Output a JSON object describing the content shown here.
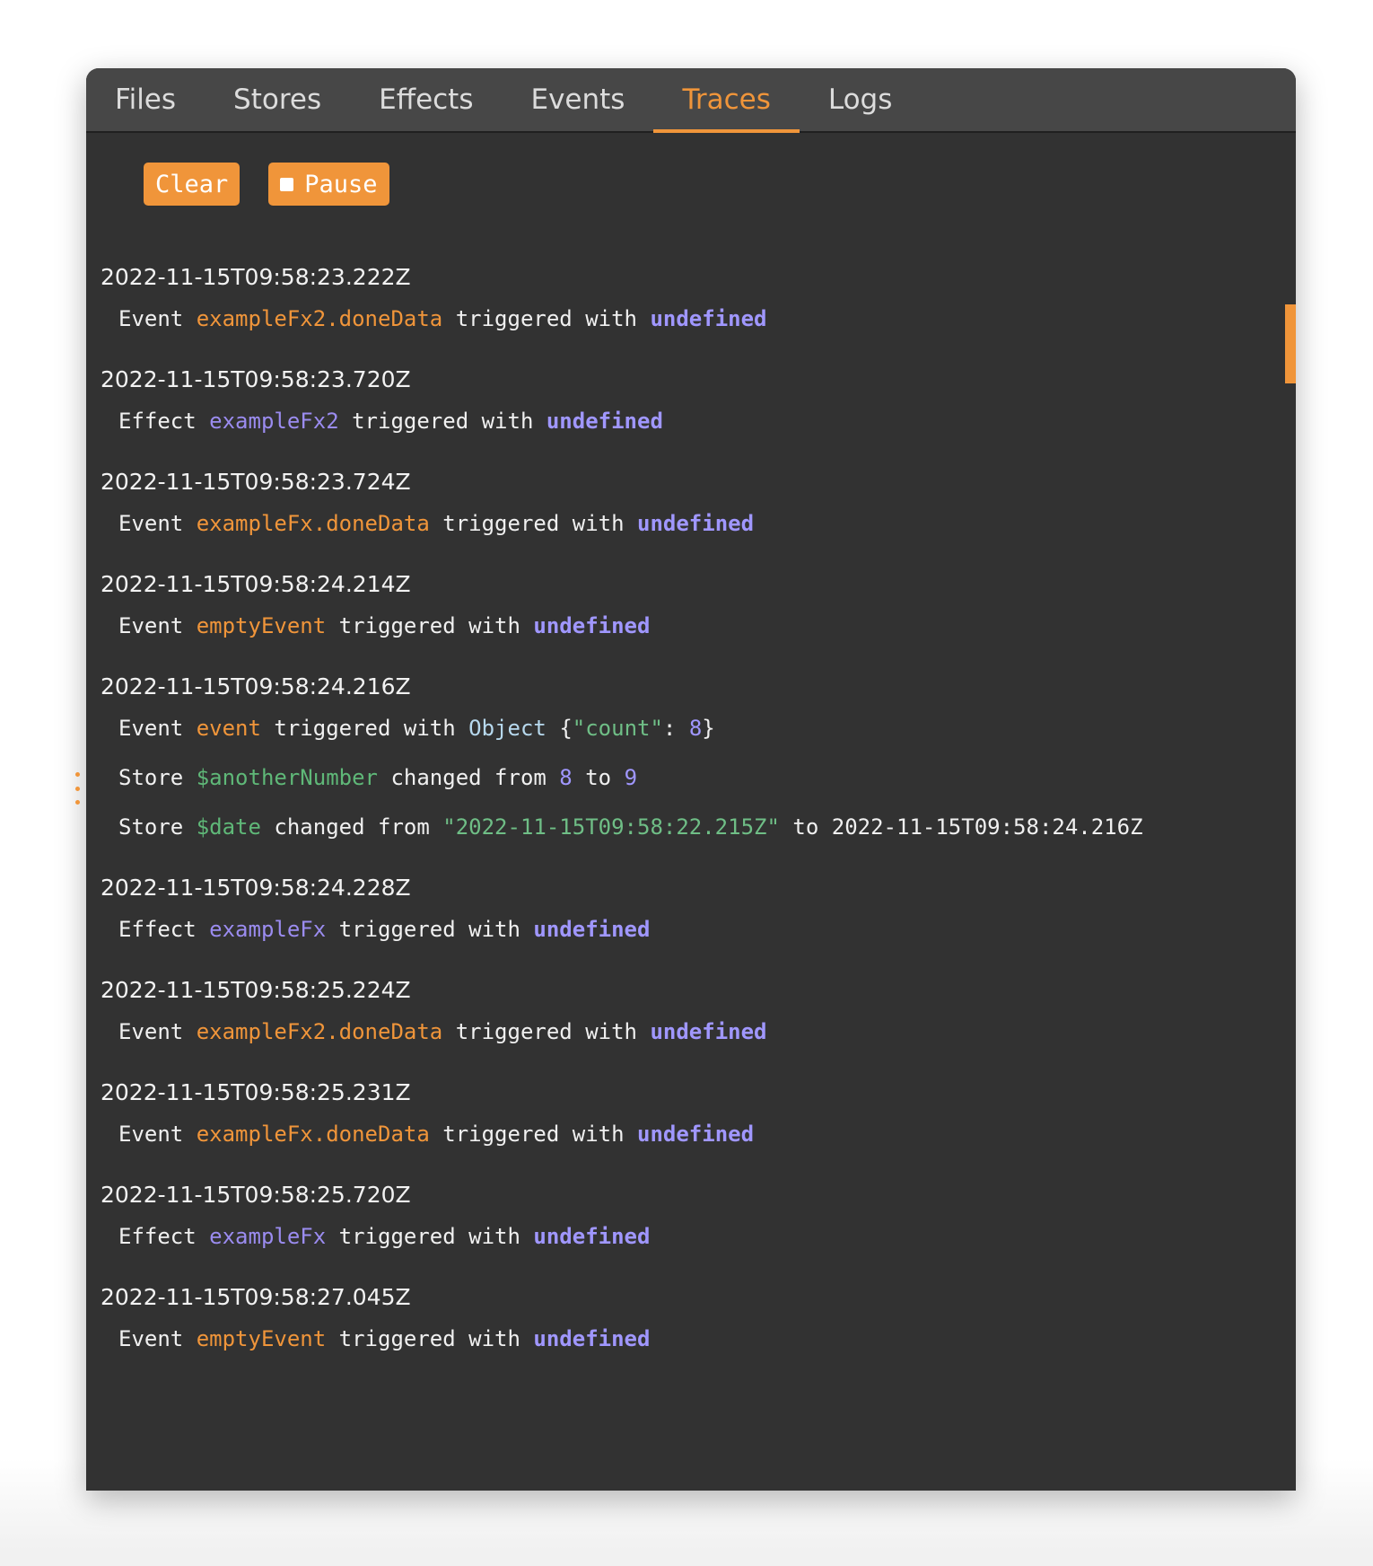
{
  "tabs": [
    {
      "label": "Files",
      "active": false
    },
    {
      "label": "Stores",
      "active": false
    },
    {
      "label": "Effects",
      "active": false
    },
    {
      "label": "Events",
      "active": false
    },
    {
      "label": "Traces",
      "active": true
    },
    {
      "label": "Logs",
      "active": false
    }
  ],
  "toolbar": {
    "clear_label": "Clear",
    "pause_label": "Pause",
    "pause_icon": "stop-square-icon"
  },
  "colors": {
    "accent": "#f0953a",
    "panel_background": "#323232",
    "tabbar_background": "#474747",
    "event_name": "#f0953a",
    "effect_name": "#9b8cf0",
    "store_name": "#5fb878",
    "undefined_value": "#a097ff",
    "string_value": "#6fbe86",
    "type_name": "#b7d9ee"
  },
  "traces": [
    {
      "timestamp": "2022-11-15T09:58:23.222Z",
      "lines": [
        {
          "kind": "Event",
          "name": "exampleFx2.doneData",
          "verb": "triggered with",
          "value": "undefined"
        }
      ]
    },
    {
      "timestamp": "2022-11-15T09:58:23.720Z",
      "lines": [
        {
          "kind": "Effect",
          "name": "exampleFx2",
          "verb": "triggered with",
          "value": "undefined"
        }
      ]
    },
    {
      "timestamp": "2022-11-15T09:58:23.724Z",
      "lines": [
        {
          "kind": "Event",
          "name": "exampleFx.doneData",
          "verb": "triggered with",
          "value": "undefined"
        }
      ]
    },
    {
      "timestamp": "2022-11-15T09:58:24.214Z",
      "lines": [
        {
          "kind": "Event",
          "name": "emptyEvent",
          "verb": "triggered with",
          "value": "undefined"
        }
      ]
    },
    {
      "timestamp": "2022-11-15T09:58:24.216Z",
      "lines": [
        {
          "kind": "Event",
          "name": "event",
          "verb": "triggered with",
          "value_type": "Object",
          "value_open": "{",
          "value_key": "\"count\"",
          "value_sep": ": ",
          "value_num": "8",
          "value_close": "}"
        },
        {
          "kind": "Store",
          "name": "$anotherNumber",
          "verb": "changed from",
          "from": "8",
          "to_word": "to",
          "to": "9"
        },
        {
          "kind": "Store",
          "name": "$date",
          "verb": "changed from",
          "from": "\"2022-11-15T09:58:22.215Z\"",
          "to_word": "to",
          "to": "2022-11-15T09:58:24.216Z"
        }
      ]
    },
    {
      "timestamp": "2022-11-15T09:58:24.228Z",
      "lines": [
        {
          "kind": "Effect",
          "name": "exampleFx",
          "verb": "triggered with",
          "value": "undefined"
        }
      ]
    },
    {
      "timestamp": "2022-11-15T09:58:25.224Z",
      "lines": [
        {
          "kind": "Event",
          "name": "exampleFx2.doneData",
          "verb": "triggered with",
          "value": "undefined"
        }
      ]
    },
    {
      "timestamp": "2022-11-15T09:58:25.231Z",
      "lines": [
        {
          "kind": "Event",
          "name": "exampleFx.doneData",
          "verb": "triggered with",
          "value": "undefined"
        }
      ]
    },
    {
      "timestamp": "2022-11-15T09:58:25.720Z",
      "lines": [
        {
          "kind": "Effect",
          "name": "exampleFx",
          "verb": "triggered with",
          "value": "undefined"
        }
      ]
    },
    {
      "timestamp": "2022-11-15T09:58:27.045Z",
      "lines": [
        {
          "kind": "Event",
          "name": "emptyEvent",
          "verb": "triggered with",
          "value": "undefined"
        }
      ]
    }
  ]
}
